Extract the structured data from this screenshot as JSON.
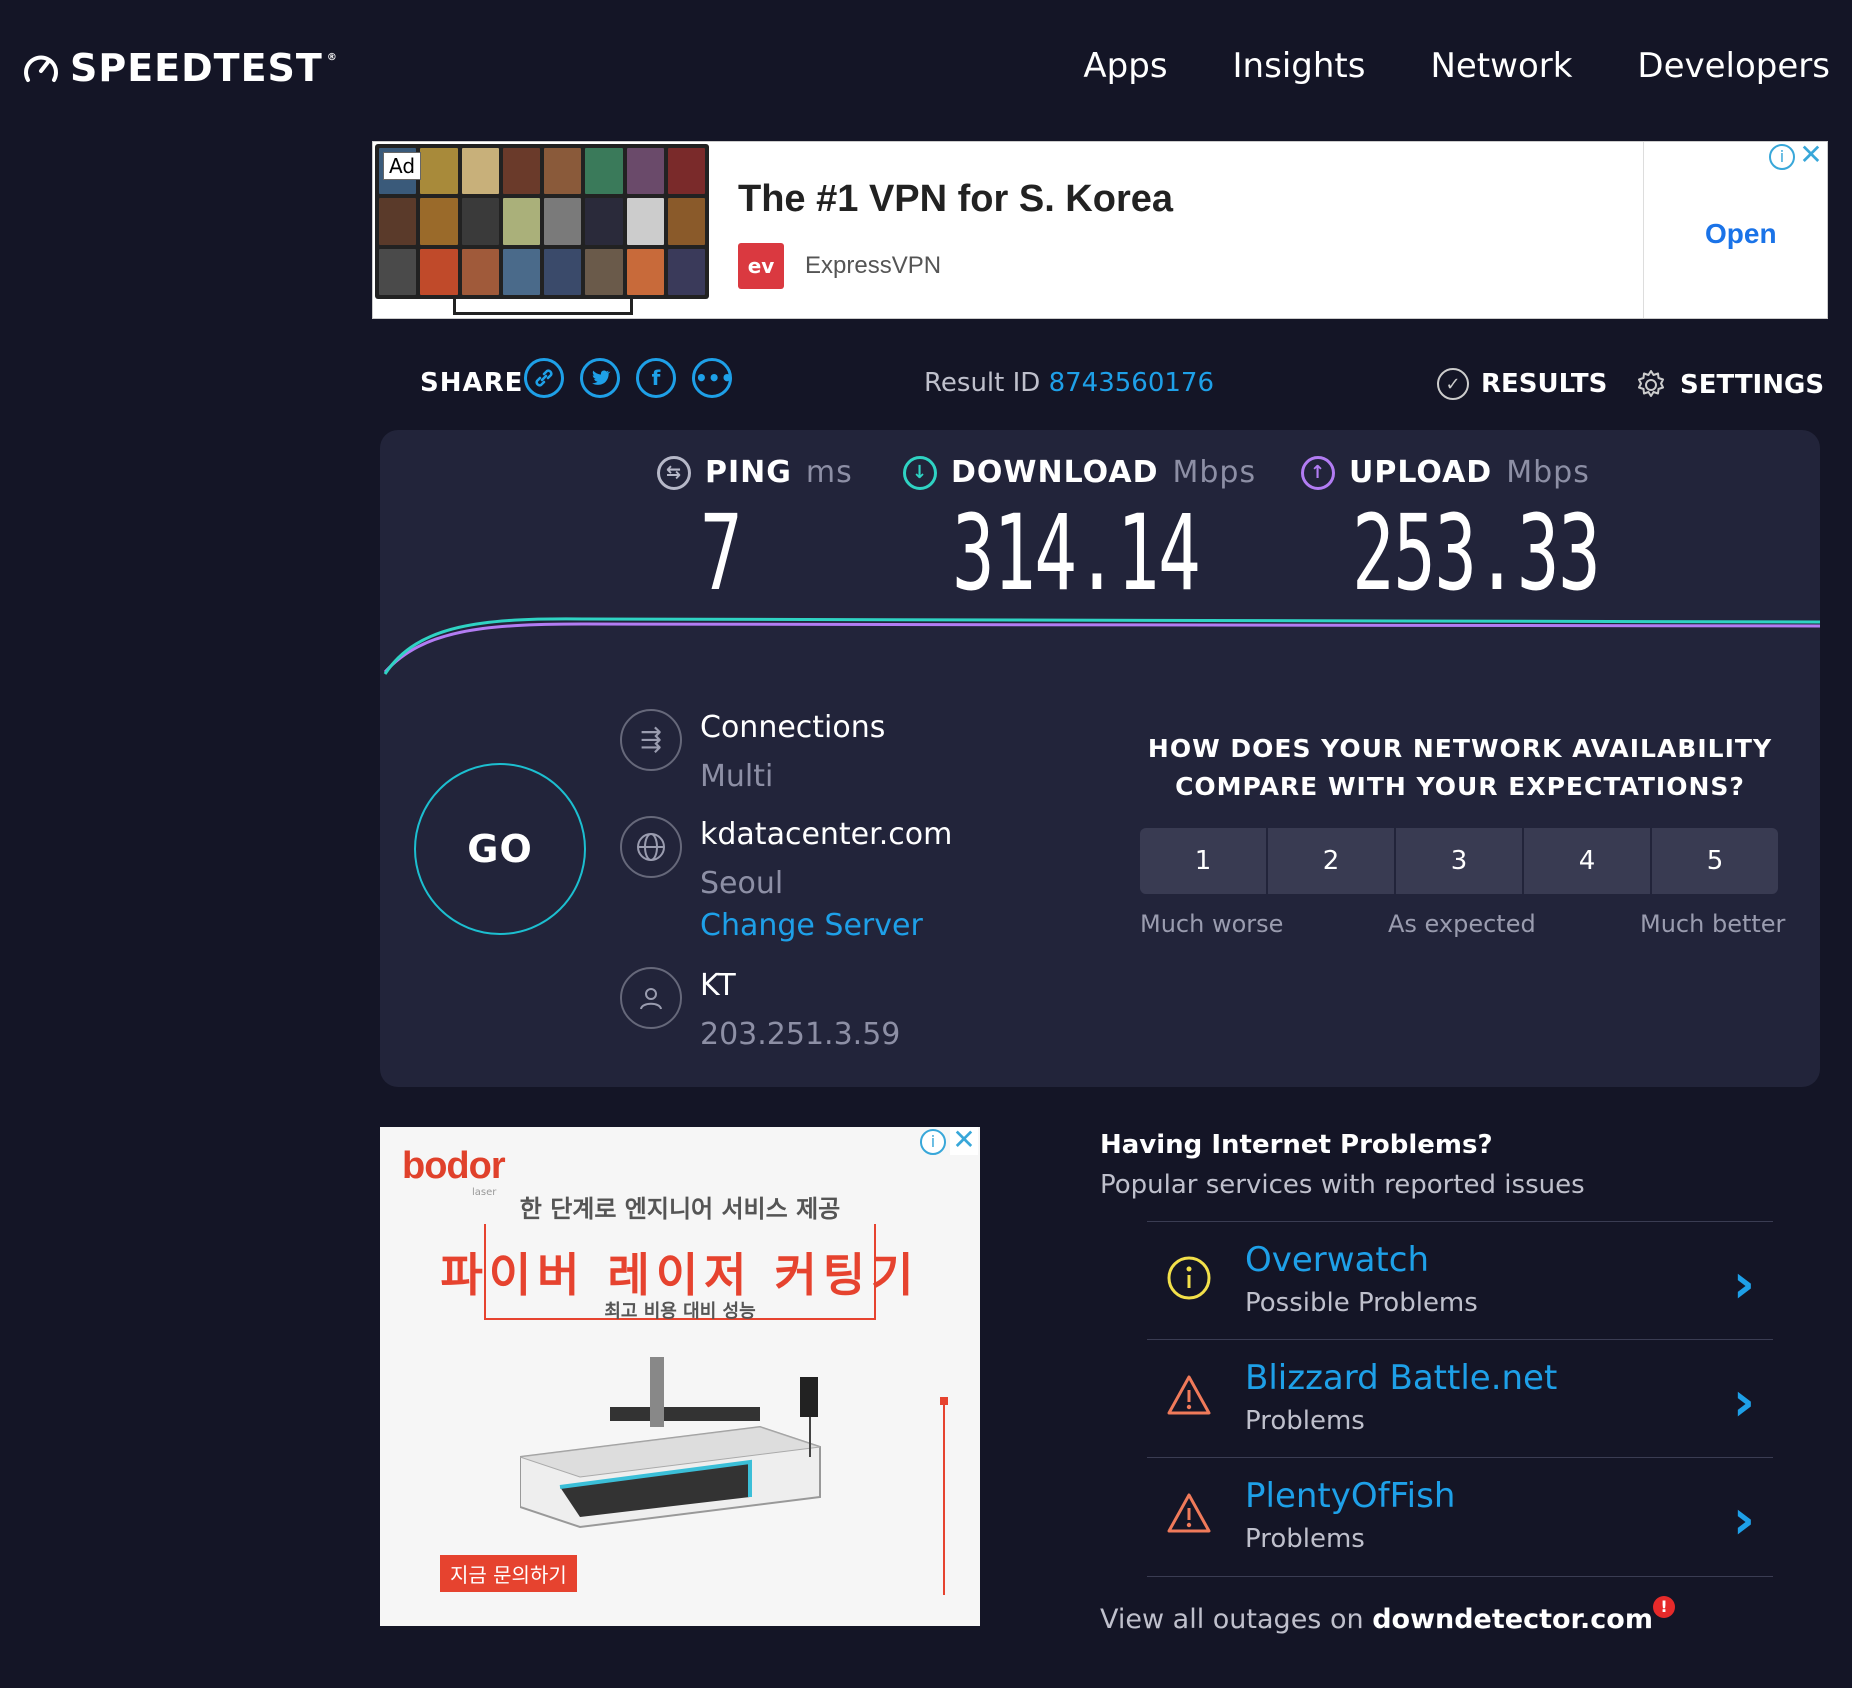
{
  "brand": {
    "name": "SPEEDTEST",
    "tm": "®"
  },
  "nav": {
    "items": [
      "Apps",
      "Insights",
      "Network",
      "Developers"
    ]
  },
  "ad_top": {
    "badge": "Ad",
    "title": "The #1 VPN for S. Korea",
    "brand_logo": "ev",
    "brand": "ExpressVPN",
    "cta": "Open",
    "info": "i",
    "close": "✕"
  },
  "share": {
    "label": "SHARE",
    "icons": [
      "link-icon",
      "twitter-icon",
      "facebook-icon",
      "more-icon"
    ]
  },
  "result": {
    "label": "Result ID",
    "id": "8743560176"
  },
  "actions": {
    "results": "RESULTS",
    "settings": "SETTINGS"
  },
  "metrics": {
    "ping": {
      "label": "PING",
      "unit": "ms",
      "value": "7",
      "color": "#b6b8c8"
    },
    "download": {
      "label": "DOWNLOAD",
      "unit": "Mbps",
      "value": "314.14",
      "color": "#2fd3c3"
    },
    "upload": {
      "label": "UPLOAD",
      "unit": "Mbps",
      "value": "253.33",
      "color": "#b27cf3"
    }
  },
  "go": {
    "label": "GO"
  },
  "connection": {
    "connections_label": "Connections",
    "connections_value": "Multi",
    "server_host": "kdatacenter.com",
    "server_city": "Seoul",
    "change_server": "Change Server",
    "isp": "KT",
    "ip": "203.251.3.59"
  },
  "survey": {
    "question_line1": "HOW DOES YOUR NETWORK AVAILABILITY",
    "question_line2": "COMPARE WITH YOUR EXPECTATIONS?",
    "options": [
      "1",
      "2",
      "3",
      "4",
      "5"
    ],
    "label_low": "Much worse",
    "label_mid": "As expected",
    "label_high": "Much better"
  },
  "ad_bottom": {
    "logo": "bodor",
    "logo_sub": "laser",
    "line1": "한 단계로 엔지니어 서비스 제공",
    "line2": "파이버 레이저 커팅기",
    "line3": "최고 비용 대비 성능",
    "cta": "지금 문의하기",
    "info": "i",
    "close": "✕"
  },
  "problems": {
    "title": "Having Internet Problems?",
    "subtitle": "Popular services with reported issues",
    "items": [
      {
        "name": "Overwatch",
        "status": "Possible Problems",
        "icon": "info-icon",
        "color": "#f2e04a"
      },
      {
        "name": "Blizzard Battle.net",
        "status": "Problems",
        "icon": "warning-icon",
        "color": "#f07a5a"
      },
      {
        "name": "PlentyOfFish",
        "status": "Problems",
        "icon": "warning-icon",
        "color": "#f07a5a"
      }
    ],
    "view_all_prefix": "View all outages on",
    "view_all_link": "downdetector.com",
    "badge": "!"
  },
  "colors": {
    "background": "#141526",
    "panel": "#22243a",
    "accent": "#1ea0e8",
    "go_ring": "#1cbfd0"
  }
}
